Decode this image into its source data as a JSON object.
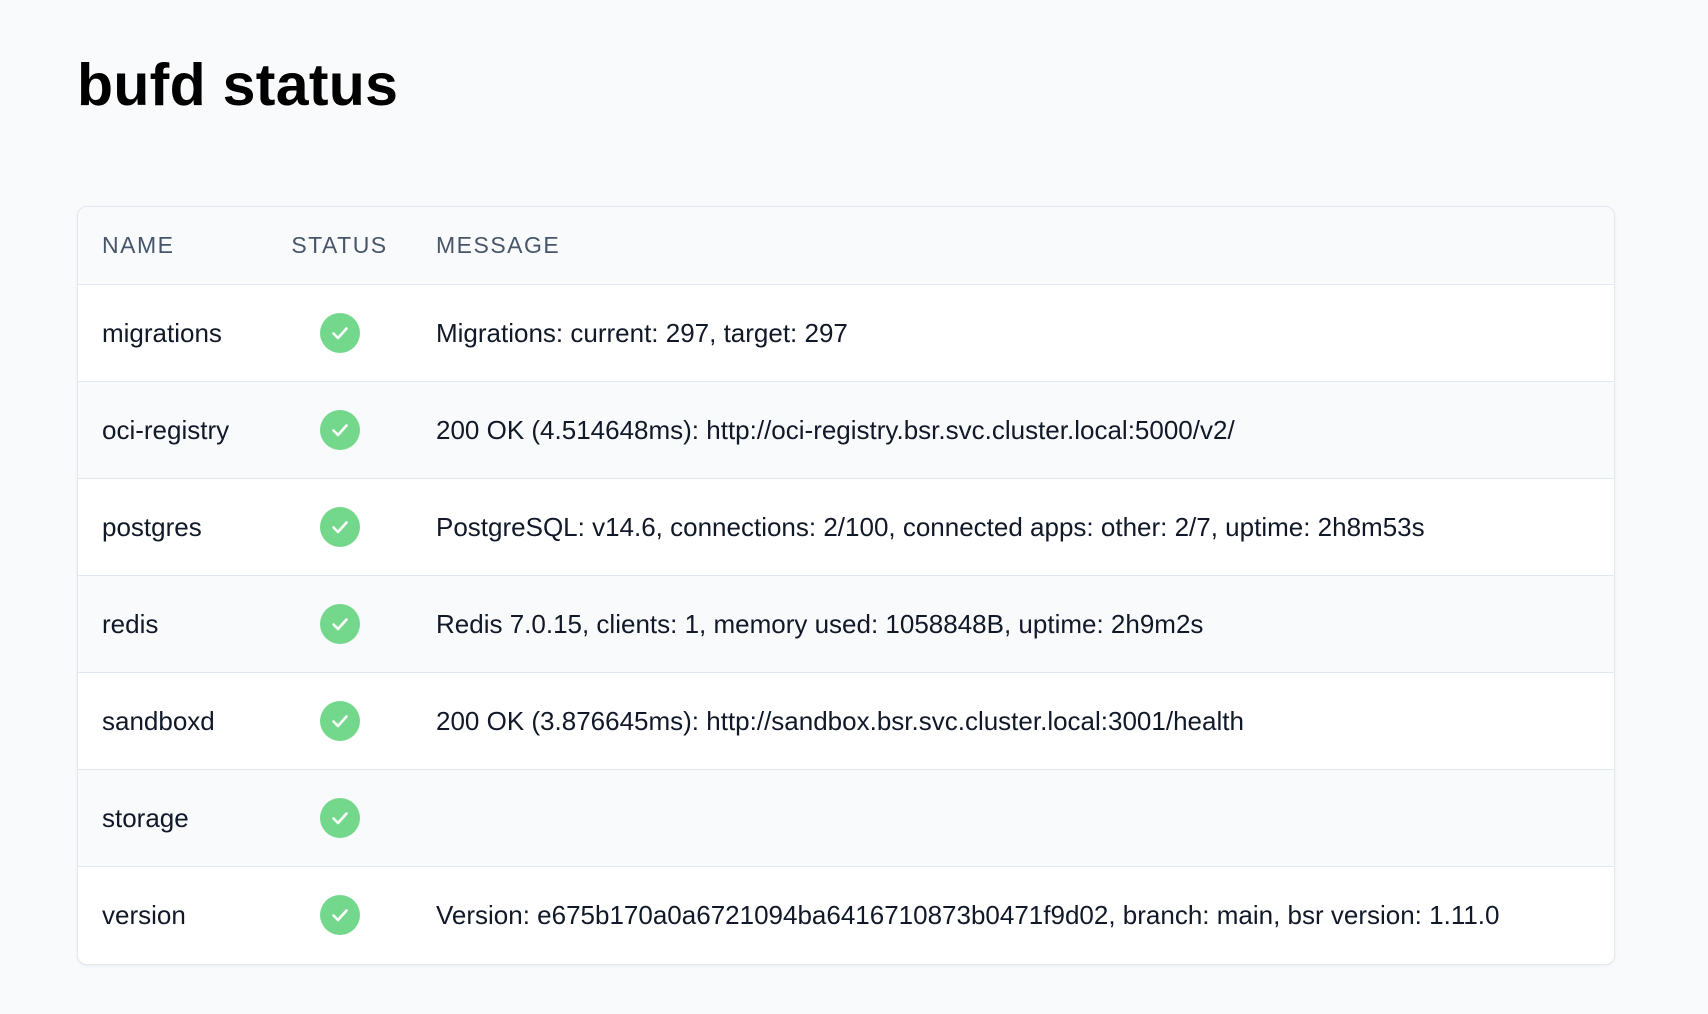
{
  "page": {
    "title": "bufd status"
  },
  "colors": {
    "ok": "#74d88c"
  },
  "table": {
    "headers": {
      "name": "NAME",
      "status": "STATUS",
      "message": "MESSAGE"
    },
    "rows": [
      {
        "name": "migrations",
        "status_icon": "check-circle-icon",
        "message": "Migrations: current: 297, target: 297"
      },
      {
        "name": "oci-registry",
        "status_icon": "check-circle-icon",
        "message": "200 OK (4.514648ms): http://oci-registry.bsr.svc.cluster.local:5000/v2/"
      },
      {
        "name": "postgres",
        "status_icon": "check-circle-icon",
        "message": "PostgreSQL: v14.6, connections: 2/100, connected apps: other: 2/7, uptime: 2h8m53s"
      },
      {
        "name": "redis",
        "status_icon": "check-circle-icon",
        "message": "Redis 7.0.15, clients: 1, memory used: 1058848B, uptime: 2h9m2s"
      },
      {
        "name": "sandboxd",
        "status_icon": "check-circle-icon",
        "message": "200 OK (3.876645ms): http://sandbox.bsr.svc.cluster.local:3001/health"
      },
      {
        "name": "storage",
        "status_icon": "check-circle-icon",
        "message": ""
      },
      {
        "name": "version",
        "status_icon": "check-circle-icon",
        "message": "Version: e675b170a0a6721094ba6416710873b0471f9d02, branch: main, bsr version: 1.11.0"
      }
    ]
  }
}
